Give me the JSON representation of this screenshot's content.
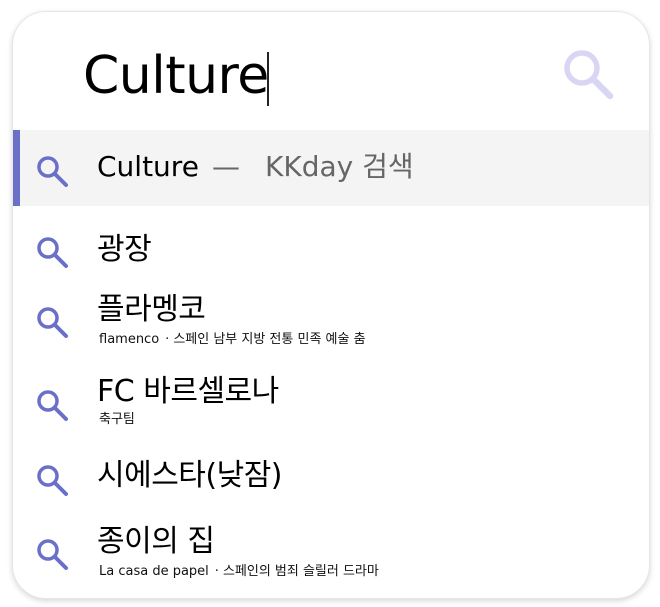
{
  "search": {
    "query": "Culture",
    "button_icon": "search-icon"
  },
  "top_suggestion": {
    "term": "Culture",
    "separator": "—",
    "provider": "KKday 검색"
  },
  "suggestions": [
    {
      "title": "광장",
      "subtitle": "",
      "description": ""
    },
    {
      "title": "플라멩코",
      "subtitle": "flamenco",
      "description": "스페인 남부 지방 전통 민족 예술 춤"
    },
    {
      "title": "FC 바르셀로나",
      "subtitle": "축구팀",
      "description": ""
    },
    {
      "title": "시에스타(낮잠)",
      "subtitle": "",
      "description": ""
    },
    {
      "title": "종이의 집",
      "subtitle": "La casa de papel",
      "description": "스페인의 범죄 슬릴러 드라마"
    }
  ],
  "colors": {
    "accent": "#6a6fc8",
    "icon": "#6a6fc8",
    "search_button_icon": "#d9d6f3",
    "highlight_bg": "#f4f4f4"
  }
}
